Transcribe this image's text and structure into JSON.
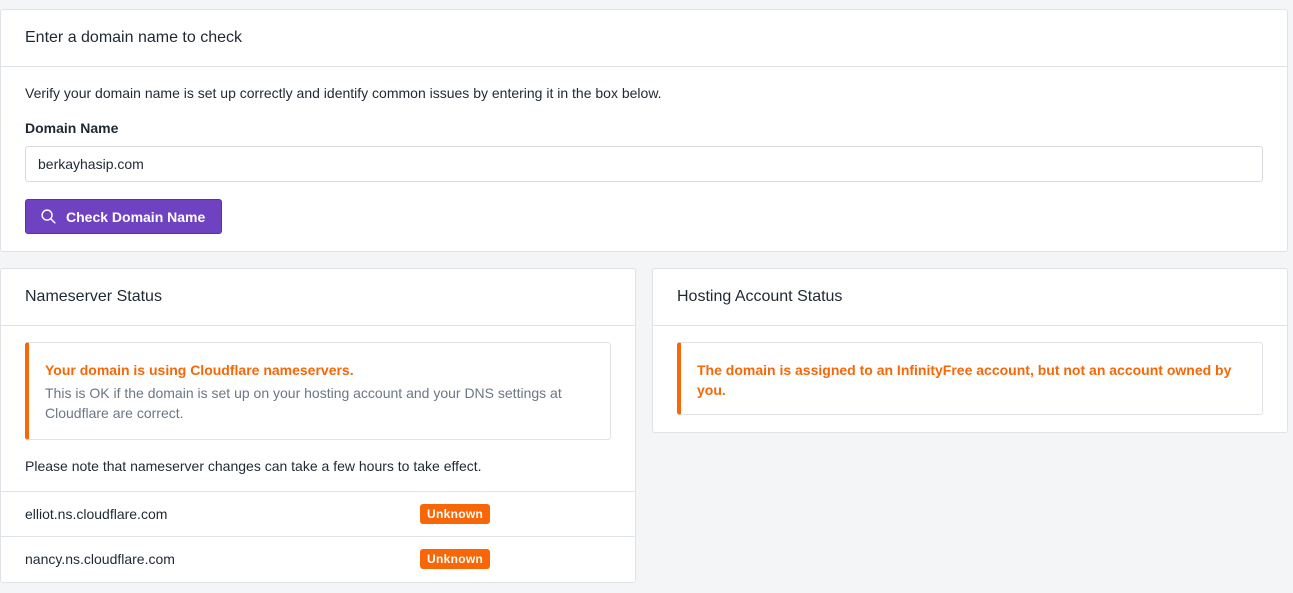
{
  "check_card": {
    "title": "Enter a domain name to check",
    "intro": "Verify your domain name is set up correctly and identify common issues by entering it in the box below.",
    "field_label": "Domain Name",
    "domain_value": "berkayhasip.com",
    "button_label": "Check Domain Name",
    "button_icon": "search-icon"
  },
  "nameserver_card": {
    "title": "Nameserver Status",
    "alert_title": "Your domain is using Cloudflare nameservers.",
    "alert_text": "This is OK if the domain is set up on your hosting account and your DNS settings at Cloudflare are correct.",
    "note": "Please note that nameserver changes can take a few hours to take effect.",
    "nameservers": [
      {
        "host": "elliot.ns.cloudflare.com",
        "status": "Unknown"
      },
      {
        "host": "nancy.ns.cloudflare.com",
        "status": "Unknown"
      }
    ]
  },
  "hosting_card": {
    "title": "Hosting Account Status",
    "alert_title": "The domain is assigned to an InfinityFree account, but not an account owned by you."
  },
  "colors": {
    "primary": "#6f42c1",
    "warning": "#f76707",
    "background": "#f4f5f7"
  }
}
